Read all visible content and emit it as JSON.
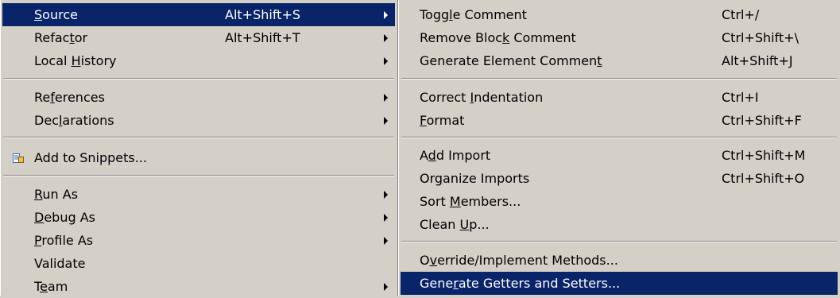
{
  "left_menu": {
    "items": [
      {
        "pre": "",
        "mn": "S",
        "post": "ource",
        "accel": "Alt+Shift+S",
        "submenu": true,
        "highlighted": true
      },
      {
        "pre": "Refac",
        "mn": "t",
        "post": "or",
        "accel": "Alt+Shift+T",
        "submenu": true
      },
      {
        "pre": "Local ",
        "mn": "H",
        "post": "istory",
        "accel": "",
        "submenu": true
      },
      {
        "pre": "Re",
        "mn": "f",
        "post": "erences",
        "accel": "",
        "submenu": true
      },
      {
        "pre": "Dec",
        "mn": "l",
        "post": "arations",
        "accel": "",
        "submenu": true
      },
      {
        "pre": "Add to Snippets...",
        "mn": "",
        "post": "",
        "accel": "",
        "submenu": false,
        "icon": "snippet-icon"
      },
      {
        "pre": "",
        "mn": "R",
        "post": "un As",
        "accel": "",
        "submenu": true
      },
      {
        "pre": "",
        "mn": "D",
        "post": "ebug As",
        "accel": "",
        "submenu": true
      },
      {
        "pre": "",
        "mn": "P",
        "post": "rofile As",
        "accel": "",
        "submenu": true
      },
      {
        "pre": "Validate",
        "mn": "",
        "post": "",
        "accel": "",
        "submenu": false
      },
      {
        "pre": "T",
        "mn": "e",
        "post": "am",
        "accel": "",
        "submenu": true
      }
    ]
  },
  "right_menu": {
    "items": [
      {
        "pre": "Togg",
        "mn": "l",
        "post": "e Comment",
        "accel": "Ctrl+/"
      },
      {
        "pre": "Remove Bloc",
        "mn": "k",
        "post": " Comment",
        "accel": "Ctrl+Shift+\\"
      },
      {
        "pre": "Generate Element Commen",
        "mn": "t",
        "post": "",
        "accel": "Alt+Shift+J"
      },
      {
        "pre": "Correct ",
        "mn": "I",
        "post": "ndentation",
        "accel": "Ctrl+I"
      },
      {
        "pre": "",
        "mn": "F",
        "post": "ormat",
        "accel": "Ctrl+Shift+F"
      },
      {
        "pre": "A",
        "mn": "d",
        "post": "d Import",
        "accel": "Ctrl+Shift+M"
      },
      {
        "pre": "Or",
        "mn": "g",
        "post": "anize Imports",
        "accel": "Ctrl+Shift+O"
      },
      {
        "pre": "Sort ",
        "mn": "M",
        "post": "embers...",
        "accel": ""
      },
      {
        "pre": "Clean ",
        "mn": "U",
        "post": "p...",
        "accel": ""
      },
      {
        "pre": "O",
        "mn": "v",
        "post": "erride/Implement Methods...",
        "accel": ""
      },
      {
        "pre": "Gene",
        "mn": "r",
        "post": "ate Getters and Setters...",
        "accel": "",
        "highlighted": true
      }
    ]
  },
  "colors": {
    "menu_bg": "#d4d0c8",
    "highlight_bg": "#0a246a",
    "highlight_text": "#ffffff"
  }
}
